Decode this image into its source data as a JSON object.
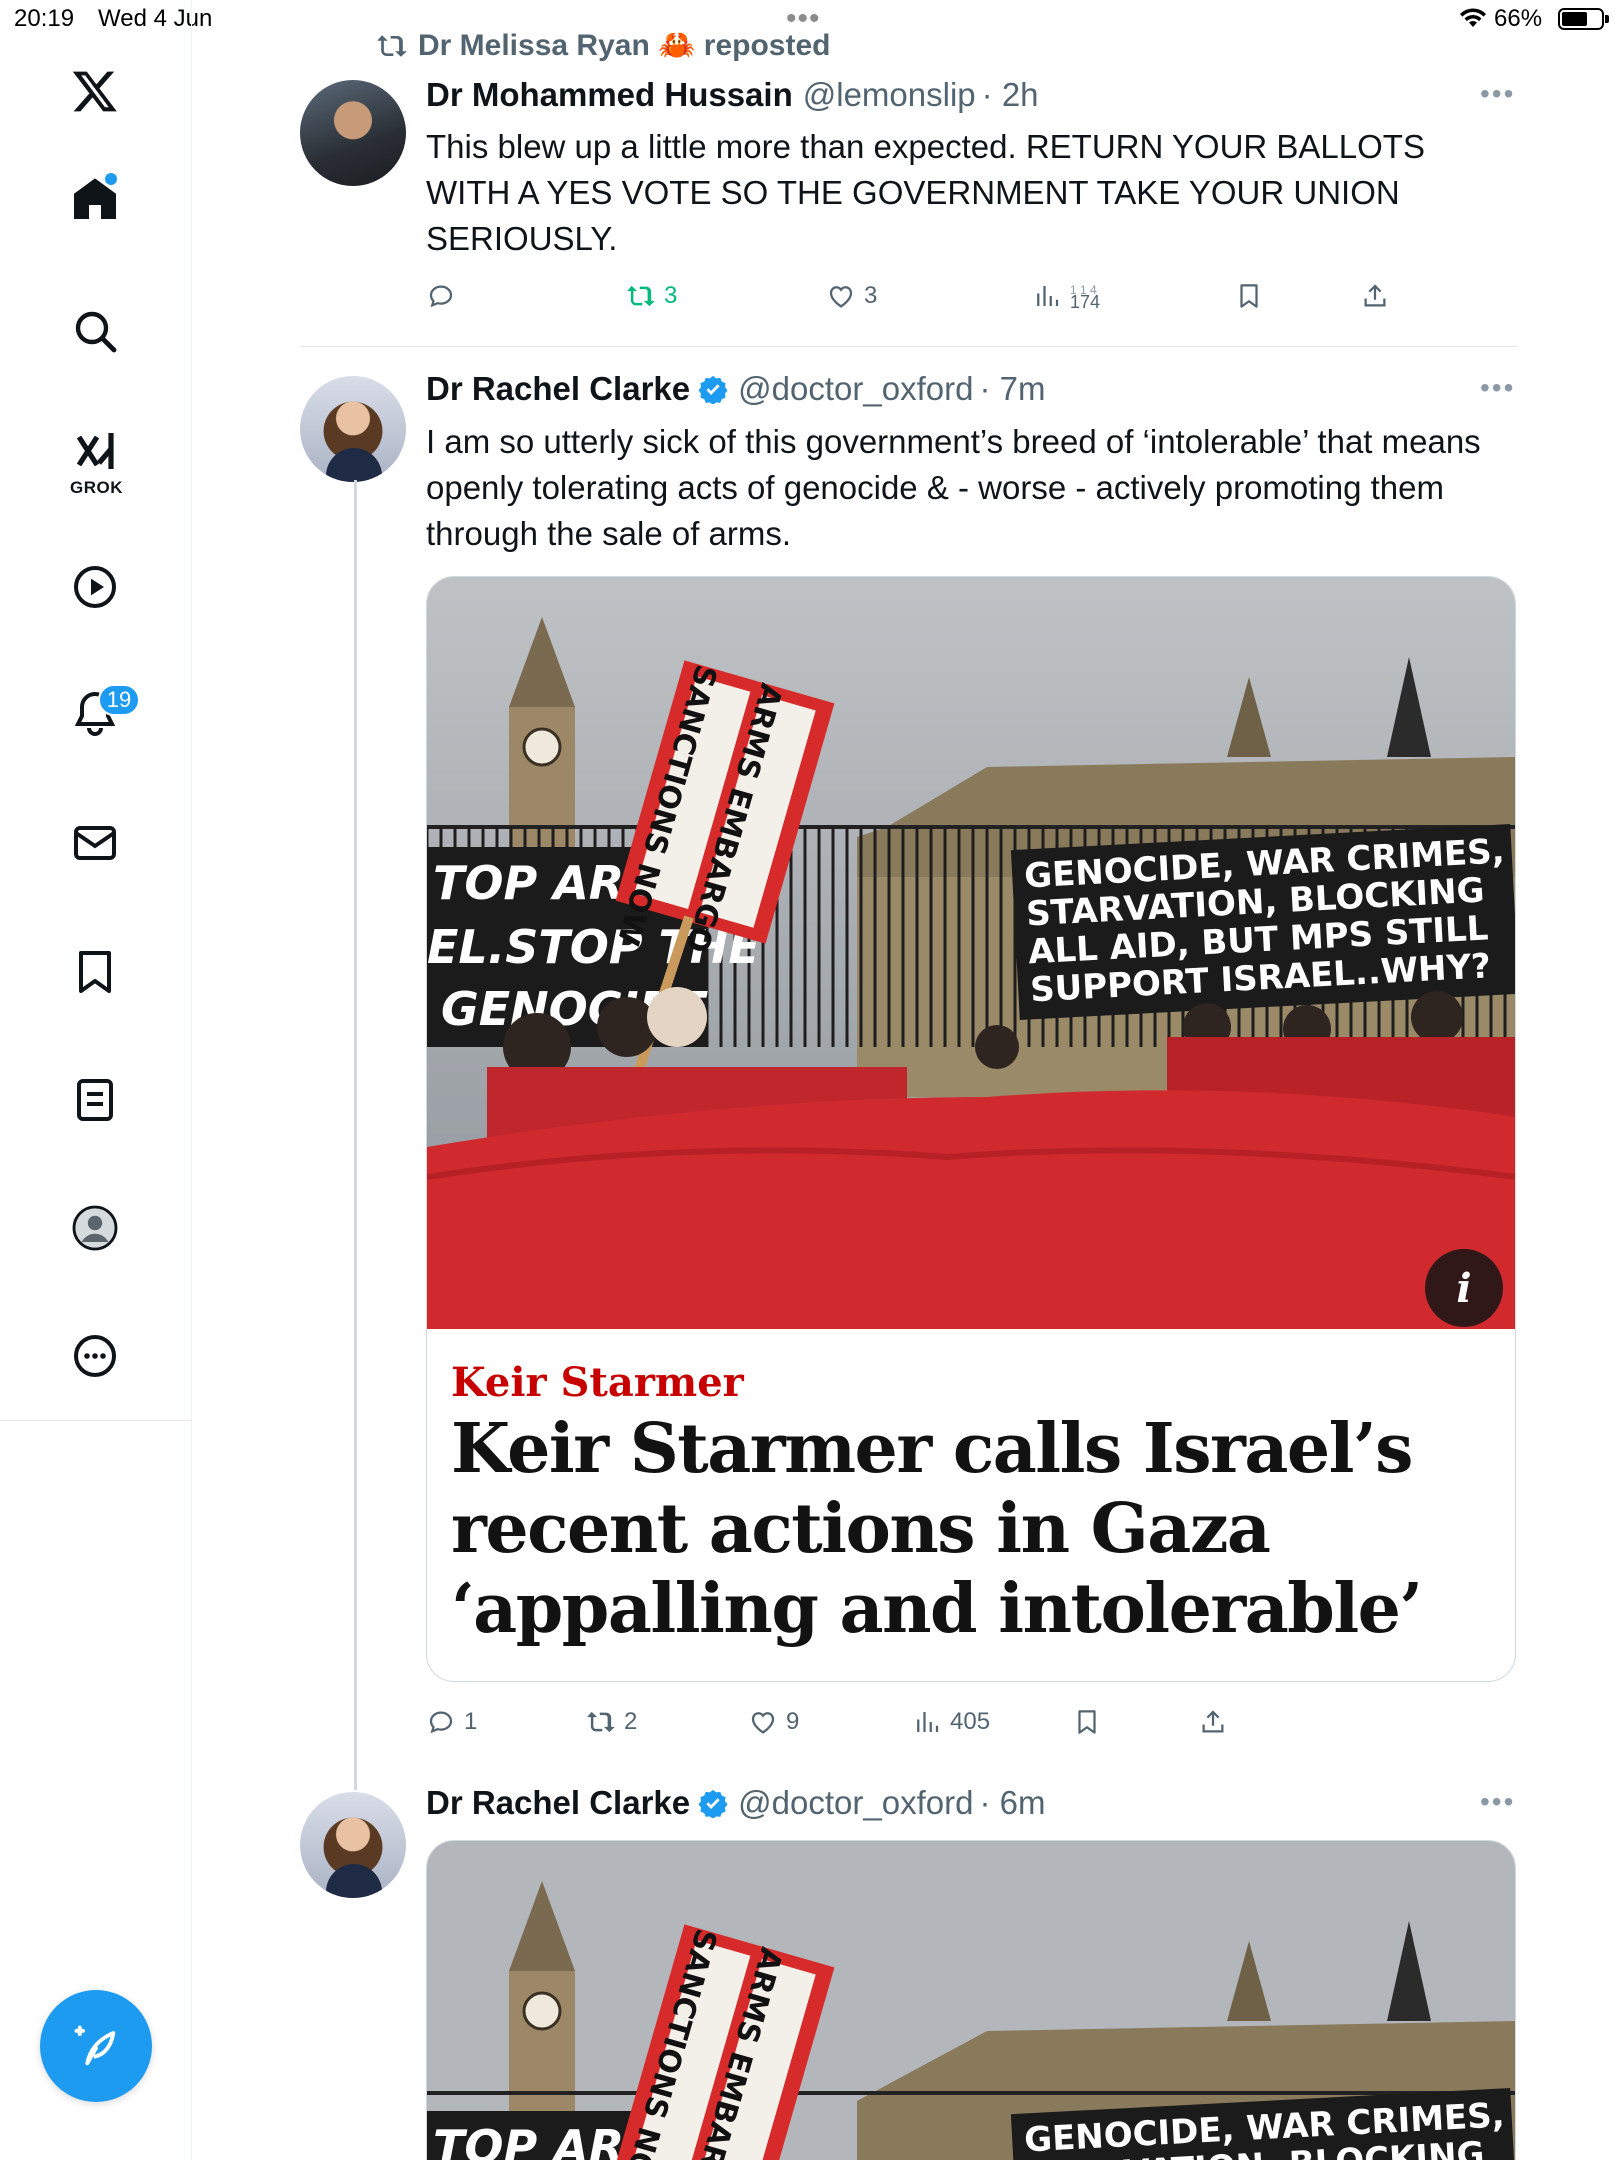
{
  "status_bar": {
    "time": "20:19",
    "date": "Wed 4 Jun",
    "battery": "66%",
    "battery_level": 0.66
  },
  "sidebar": {
    "grok_label": "GROK",
    "notifications_count": "19"
  },
  "repost_banner": {
    "text": "Dr Melissa Ryan 🦀 reposted"
  },
  "tweets": [
    {
      "name": "Dr Mohammed Hussain",
      "handle": "@lemonslip",
      "time": "· 2h",
      "text": "This blew up a little more than expected. RETURN YOUR BALLOTS WITH A YES VOTE SO THE GOVERNMENT TAKE YOUR UNION SERIOUSLY.",
      "reposts": "3",
      "likes": "3",
      "views_top": "1 1 4",
      "views": "174"
    },
    {
      "name": "Dr Rachel Clarke",
      "handle": "@doctor_oxford",
      "time": "· 7m",
      "text": "I am so utterly sick of this government’s breed of ‘intolerable’ that means openly tolerating acts of genocide & - worse - actively promoting them through the sale of arms.",
      "card": {
        "kicker": "Keir Starmer",
        "headline": "Keir Starmer calls Israel’s recent actions in Gaza ‘appalling and intolerable’",
        "info": "i",
        "photo_signs": {
          "left_banner": [
            "TOP ARMIN",
            "EL.STOP THE",
            "GENOCIDE"
          ],
          "right_banner": [
            "GENOCIDE, WAR CRIMES,",
            "STARVATION, BLOCKING",
            "ALL AID, BUT MPS STILL",
            "SUPPORT ISRAEL..WHY?"
          ],
          "placard": [
            "ARMS EMBARGO",
            "SANCTIONS NOW"
          ]
        }
      },
      "replies": "1",
      "reposts": "2",
      "likes": "9",
      "views": "405"
    },
    {
      "name": "Dr Rachel Clarke",
      "handle": "@doctor_oxford",
      "time": "· 6m"
    }
  ],
  "colors": {
    "accent": "#1d9bf0",
    "repost_green": "#00ba7c",
    "muted": "#536471",
    "guardian_red": "#c70000"
  }
}
